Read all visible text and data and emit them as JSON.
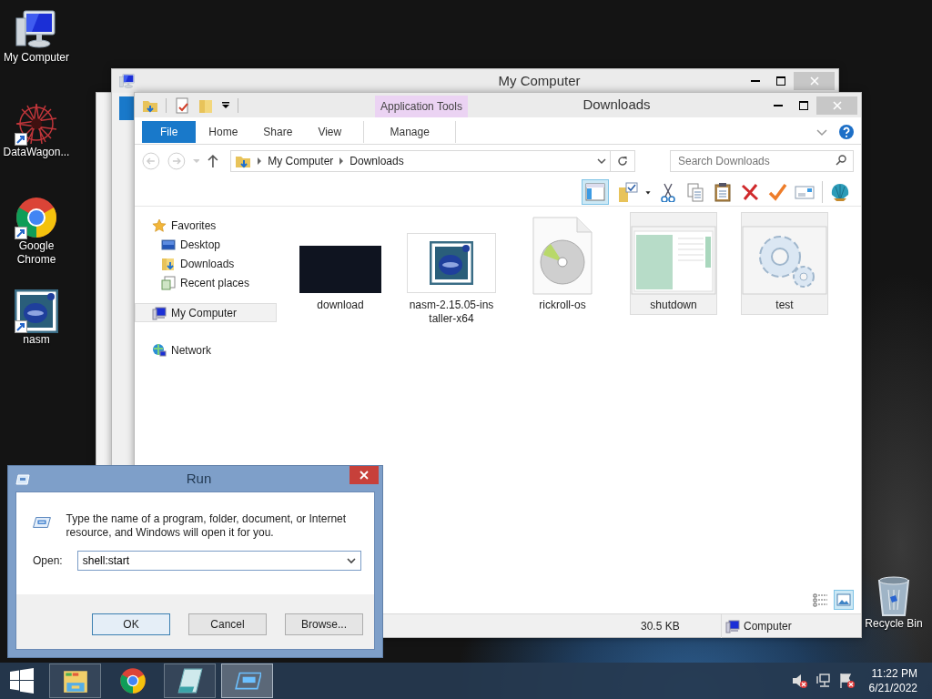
{
  "desktop_icons": [
    {
      "label": "My Computer",
      "kind": "computer",
      "shortcut": false
    },
    {
      "label": "DataWagon...",
      "kind": "datawagon",
      "shortcut": true
    },
    {
      "label": "Google Chrome",
      "kind": "chrome",
      "shortcut": true
    },
    {
      "label": "nasm",
      "kind": "nasm",
      "shortcut": true
    },
    {
      "label": "Recycle Bin",
      "kind": "recycle",
      "shortcut": false
    }
  ],
  "back_window": {
    "title": "My Computer"
  },
  "explorer": {
    "title": "Downloads",
    "context_group": "Application Tools",
    "ribbon_tabs": [
      {
        "label": "File",
        "kind": "file"
      },
      {
        "label": "Home",
        "kind": "tab"
      },
      {
        "label": "Share",
        "kind": "tab"
      },
      {
        "label": "View",
        "kind": "tab"
      },
      {
        "label": "Manage",
        "kind": "context"
      }
    ],
    "breadcrumb": [
      "My Computer",
      "Downloads"
    ],
    "search": {
      "placeholder": "Search Downloads"
    },
    "nav": [
      {
        "label": "Favorites",
        "kind": "star",
        "selected": false,
        "children": [
          {
            "label": "Desktop",
            "kind": "desktop",
            "selected": false
          },
          {
            "label": "Downloads",
            "kind": "downloads",
            "selected": false
          },
          {
            "label": "Recent places",
            "kind": "recent",
            "selected": false
          }
        ]
      },
      {
        "label": "My Computer",
        "kind": "computer",
        "selected": true
      },
      {
        "label": "Network",
        "kind": "network",
        "selected": false
      }
    ],
    "files": [
      {
        "name": "download",
        "kind": "photo",
        "selected": false
      },
      {
        "name": "nasm-2.15.05-installer-x64",
        "kind": "nasm",
        "selected": false
      },
      {
        "name": "rickroll-os",
        "kind": "disc",
        "selected": false
      },
      {
        "name": "shutdown",
        "kind": "window",
        "selected": true
      },
      {
        "name": "test",
        "kind": "gears",
        "selected": true
      }
    ],
    "views": [
      {
        "kind": "details",
        "selected": false
      },
      {
        "kind": "large",
        "selected": true
      }
    ],
    "status": {
      "size": "30.5 KB",
      "location": "Computer"
    }
  },
  "run": {
    "title": "Run",
    "description": "Type the name of a program, folder, document, or Internet resource, and Windows will open it for you.",
    "label": "Open:",
    "value": "shell:start",
    "buttons": [
      "OK",
      "Cancel",
      "Browse..."
    ]
  },
  "taskbar": {
    "apps": [
      {
        "kind": "explorer",
        "open": true,
        "selected": false
      },
      {
        "kind": "chrome",
        "open": false,
        "selected": false
      },
      {
        "kind": "notepad",
        "open": true,
        "selected": false
      },
      {
        "kind": "run",
        "open": true,
        "selected": true
      }
    ],
    "clock": {
      "time": "11:22 PM",
      "date": "6/21/2022"
    }
  }
}
